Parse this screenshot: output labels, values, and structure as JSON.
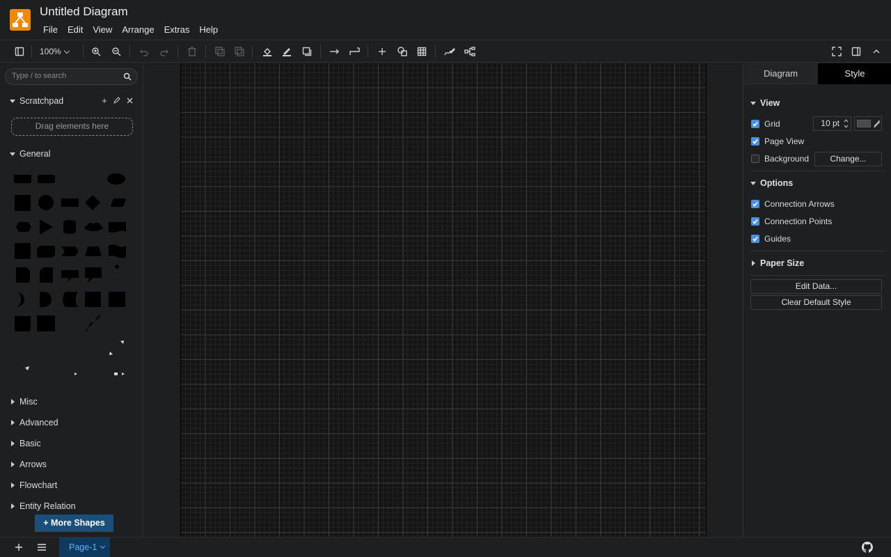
{
  "header": {
    "title": "Untitled Diagram",
    "menu": [
      "File",
      "Edit",
      "View",
      "Arrange",
      "Extras",
      "Help"
    ]
  },
  "toolbar": {
    "zoom": "100%"
  },
  "left_panel": {
    "search_placeholder": "Type / to search",
    "scratchpad": {
      "title": "Scratchpad",
      "drop_hint": "Drag elements here"
    },
    "general_title": "General",
    "libraries": [
      "Misc",
      "Advanced",
      "Basic",
      "Arrows",
      "Flowchart",
      "Entity Relation"
    ],
    "more_shapes": "+ More Shapes"
  },
  "right_panel": {
    "tabs": [
      "Diagram",
      "Style"
    ],
    "active_tab": "Style",
    "view": {
      "title": "View",
      "grid_label": "Grid",
      "grid_checked": true,
      "grid_size": "10 pt",
      "grid_color": "#4a4a4a",
      "page_view_label": "Page View",
      "page_view_checked": true,
      "background_label": "Background",
      "background_checked": false,
      "change_button": "Change..."
    },
    "options": {
      "title": "Options",
      "connection_arrows": "Connection Arrows",
      "connection_points": "Connection Points",
      "guides": "Guides"
    },
    "paper_size": "Paper Size",
    "edit_data": "Edit Data...",
    "clear_default_style": "Clear Default Style"
  },
  "bottom_bar": {
    "page_tab": "Page-1"
  },
  "colors": {
    "accent": "#f08705",
    "canvas_bg": "#151515",
    "panel_bg": "#1e1f21",
    "checkbox": "#4a90e2",
    "page_tab": "#0e3a5f"
  }
}
